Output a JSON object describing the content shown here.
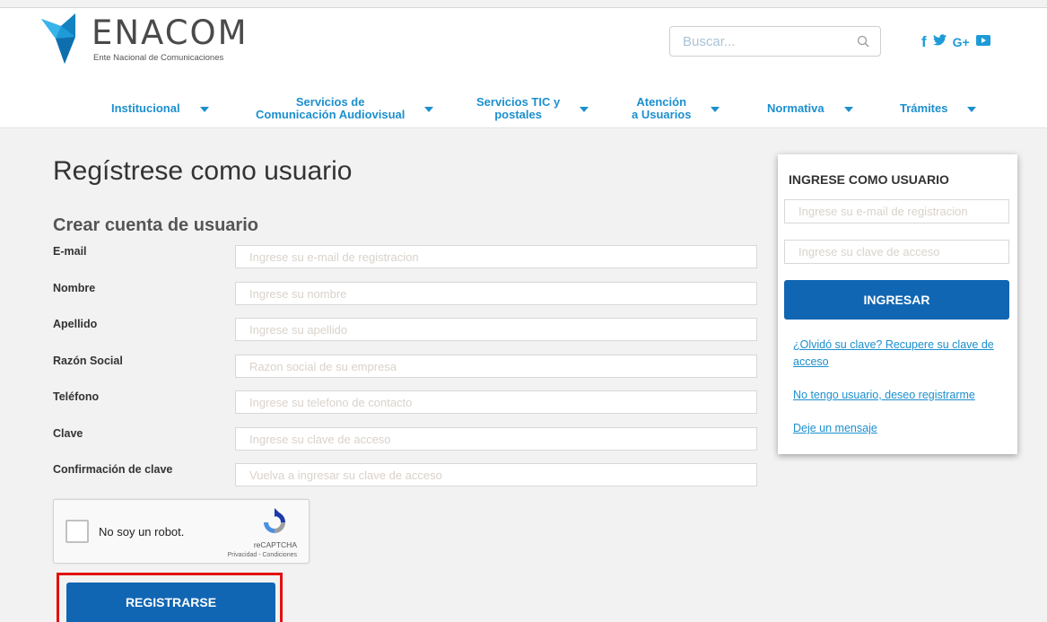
{
  "header": {
    "logo_title": "ENACOM",
    "logo_subtitle": "Ente Nacional de Comunicaciones",
    "search_placeholder": "Buscar...",
    "social": {
      "facebook": "f",
      "googleplus": "G+"
    }
  },
  "nav": {
    "items": [
      {
        "label": "Institucional"
      },
      {
        "label": "Servicios de\nComunicación Audiovisual"
      },
      {
        "label": "Servicios TIC y\npostales"
      },
      {
        "label": "Atención\na Usuarios"
      },
      {
        "label": "Normativa"
      },
      {
        "label": "Trámites"
      }
    ]
  },
  "main": {
    "page_title": "Regístrese como usuario",
    "section_title": "Crear cuenta de usuario",
    "fields": [
      {
        "label": "E-mail",
        "placeholder": "Ingrese su e-mail de registracion",
        "value": ""
      },
      {
        "label": "Nombre",
        "placeholder": "Ingrese su nombre",
        "value": ""
      },
      {
        "label": "Apellido",
        "placeholder": "Ingrese su apellido",
        "value": ""
      },
      {
        "label": "Razón Social",
        "placeholder": "Razon social de su empresa",
        "value": ""
      },
      {
        "label": "Teléfono",
        "placeholder": "Ingrese su telefono de contacto",
        "value": ""
      },
      {
        "label": "Clave",
        "placeholder": "Ingrese su clave de acceso",
        "value": ""
      },
      {
        "label": "Confirmación de clave",
        "placeholder": "Vuelva a ingresar su clave de acceso",
        "value": ""
      }
    ],
    "captcha": {
      "label": "No soy un robot.",
      "brand": "reCAPTCHA",
      "links": "Privacidad - Condiciones",
      "checked": false
    },
    "register_label": "REGISTRARSE"
  },
  "login": {
    "title": "INGRESE COMO USUARIO",
    "email_placeholder": "Ingrese su e-mail de registracion",
    "password_placeholder": "Ingrese su clave de acceso",
    "button_label": "INGRESAR",
    "forgot_link": "¿Olvidó su clave? Recupere su clave de acceso",
    "register_link": "No tengo usuario, deseo registrarme",
    "message_link": "Deje un mensaje"
  },
  "colors": {
    "brand_blue": "#1c8fce",
    "button_blue": "#1166b3",
    "highlight_red": "#e31010"
  }
}
